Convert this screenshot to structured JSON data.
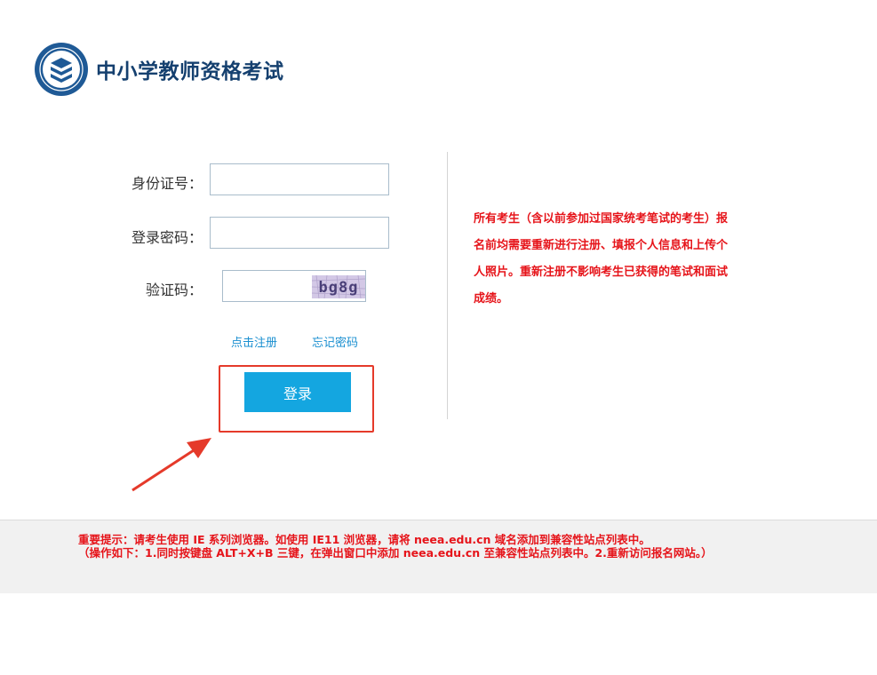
{
  "header": {
    "title": "中小学教师资格考试"
  },
  "form": {
    "id_label": "身份证号：",
    "id_value": "",
    "password_label": "登录密码：",
    "password_value": "",
    "captcha_label": "验证码：",
    "captcha_value": "",
    "captcha_text": "bg8g"
  },
  "links": {
    "register": "点击注册",
    "forgot": "忘记密码"
  },
  "login": {
    "label": "登录"
  },
  "notice": {
    "text": "所有考生（含以前参加过国家统考笔试的考生）报名前均需要重新进行注册、填报个人信息和上传个人照片。重新注册不影响考生已获得的笔试和面试成绩。"
  },
  "footer": {
    "line1": "重要提示：请考生使用 IE 系列浏览器。如使用 IE11 浏览器，请将 neea.edu.cn 域名添加到兼容性站点列表中。",
    "line2": "（操作如下：1.同时按键盘 ALT+X+B 三键，在弹出窗口中添加 neea.edu.cn 至兼容性站点列表中。2.重新访问报名网站。）"
  },
  "colors": {
    "brand": "#15406f",
    "accent": "#14a6e0",
    "link": "#1a8fd0",
    "alert": "#e6141a",
    "highlight": "#e53a2a"
  }
}
